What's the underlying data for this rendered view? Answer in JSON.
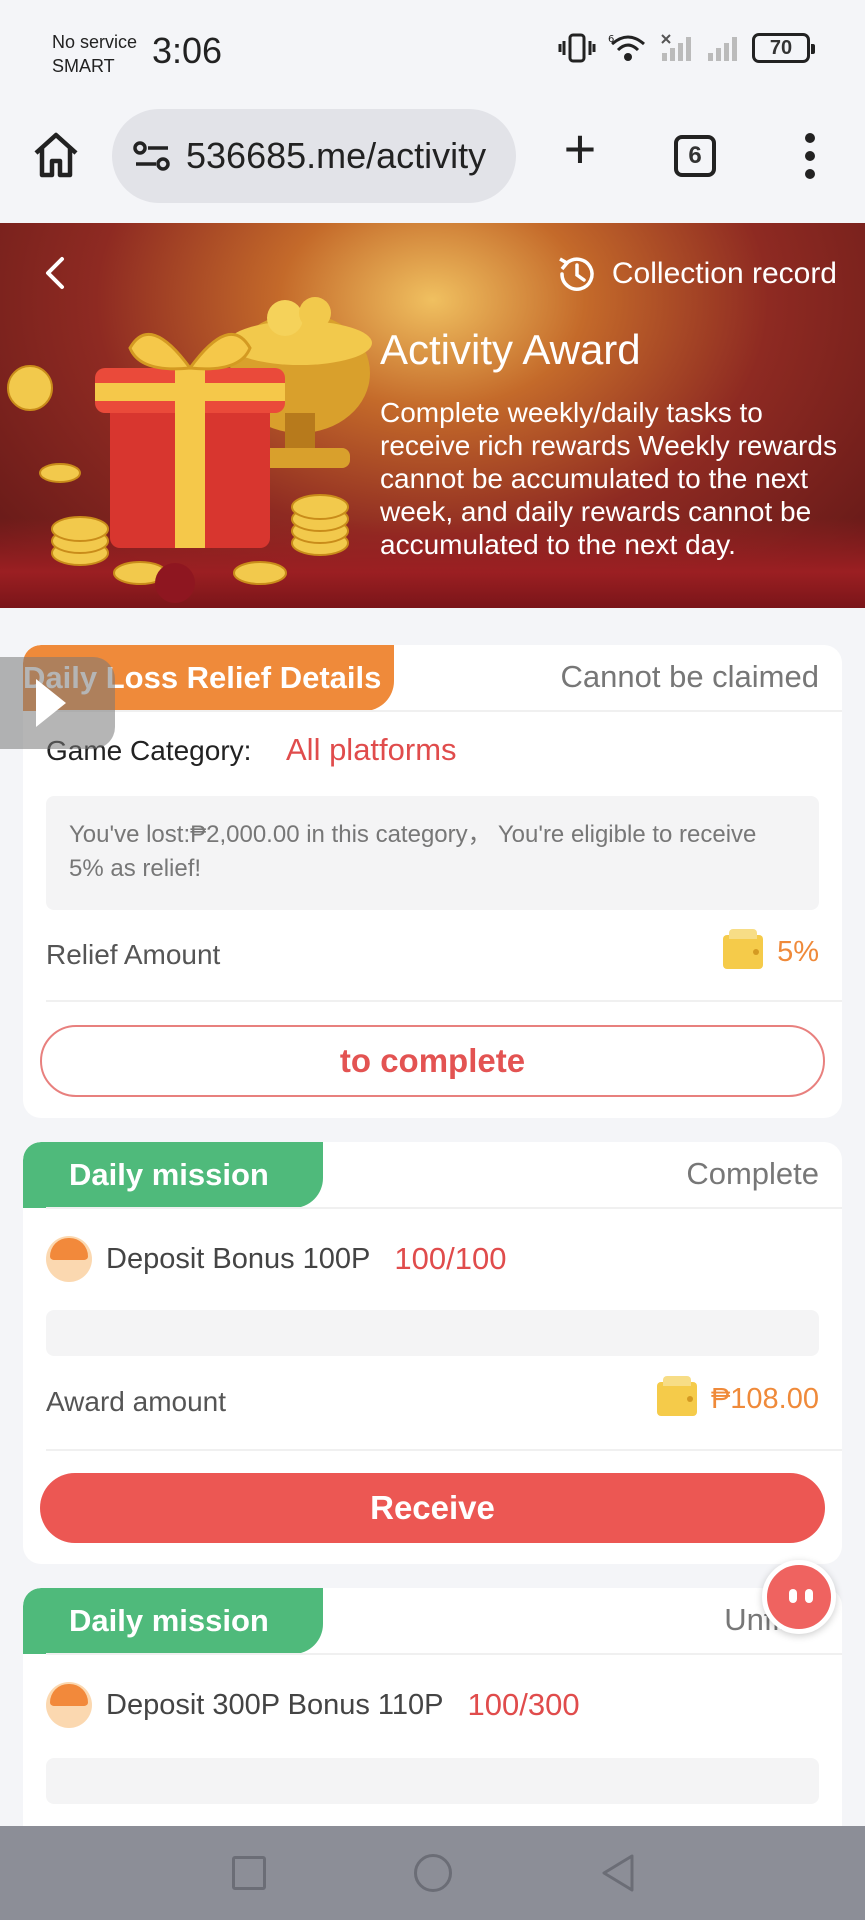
{
  "status_bar": {
    "carrier_line1": "No service",
    "carrier_line2": "SMART",
    "time": "3:06",
    "battery": "70",
    "icons": [
      "vibrate-icon",
      "wifi-icon",
      "signal-icon",
      "signal-icon"
    ]
  },
  "browser": {
    "url": "536685.me/activity",
    "tab_count": "6",
    "icons": [
      "home-icon",
      "site-settings-icon",
      "plus-icon",
      "tabs-icon",
      "more-vert-icon"
    ]
  },
  "banner": {
    "collection_label": "Collection record",
    "title": "Activity Award",
    "description": "Complete weekly/daily tasks to receive rich rewards Weekly rewards cannot be accumulated to the next week, and daily rewards cannot be accumulated to the next day."
  },
  "relief_card": {
    "tab_label": "Daily Loss Relief Details",
    "status": "Cannot be claimed",
    "category_label": "Game Category:",
    "category_value": "All platforms",
    "info_text": "You've lost:₱2,000.00 in this category， You're eligible to receive 5% as relief!",
    "amount_label": "Relief Amount",
    "amount_value": "5%",
    "button_label": "to complete"
  },
  "mission_cards": [
    {
      "tab_label": "Daily mission",
      "status": "Complete",
      "task_name": "Deposit Bonus 100P",
      "task_progress": "100/100",
      "progress_fraction": 1.0,
      "award_label": "Award amount",
      "award_value": "₱108.00",
      "button_label": "Receive"
    },
    {
      "tab_label": "Daily mission",
      "status": "Unfinis",
      "task_name": "Deposit 300P Bonus 110P",
      "task_progress": "100/300",
      "progress_fraction": 0.333
    }
  ],
  "colors": {
    "accent_red": "#ec5753",
    "tab_orange": "#ef8a3a",
    "tab_green": "#4fba7b",
    "amount_orange": "#ef8a3a"
  }
}
